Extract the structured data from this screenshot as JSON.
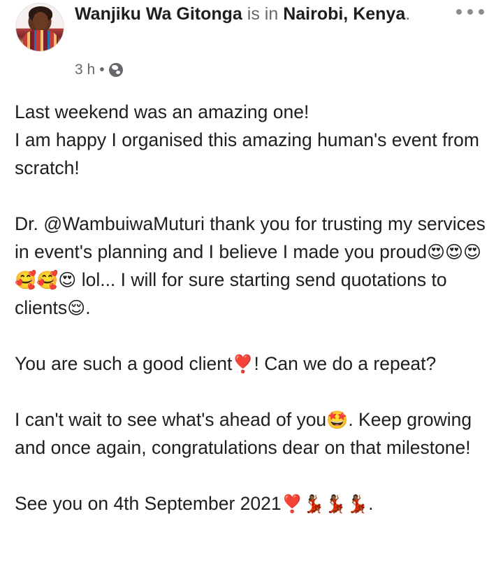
{
  "post": {
    "author": "Wanjiku Wa Gitonga",
    "connector": "is in",
    "location": "Nairobi, Kenya",
    "location_suffix": ".",
    "time": "3 h",
    "separator": "•",
    "privacy_icon": "globe-icon",
    "more_icon": "more-options-icon"
  },
  "content": {
    "p1_line1": "Last weekend was an amazing one!",
    "p1_line2": "I am happy I organised this amazing human's event from scratch!",
    "p2_part1": "Dr. @WambuiwaMuturi thank you for trusting my services in event's planning and I believe I made you proud",
    "p2_emojis1": "😍😍😍🥰🥰😍",
    "p2_part2": " lol... I will for sure starting send quotations to clients",
    "p2_emoji2": "😌",
    "p2_end": ".",
    "p3_part1": "You are such a good client",
    "p3_emoji": "❣️",
    "p3_part2": "! Can we do a repeat?",
    "p4_part1": "I can't wait to see what's ahead of you",
    "p4_emoji": "🤩",
    "p4_part2": ". Keep growing and once again, congratulations dear on that milestone!",
    "p5_part1": "See you on 4th September 2021",
    "p5_emojis": "❣️💃🏾💃🏾💃🏾",
    "p5_end": "."
  }
}
